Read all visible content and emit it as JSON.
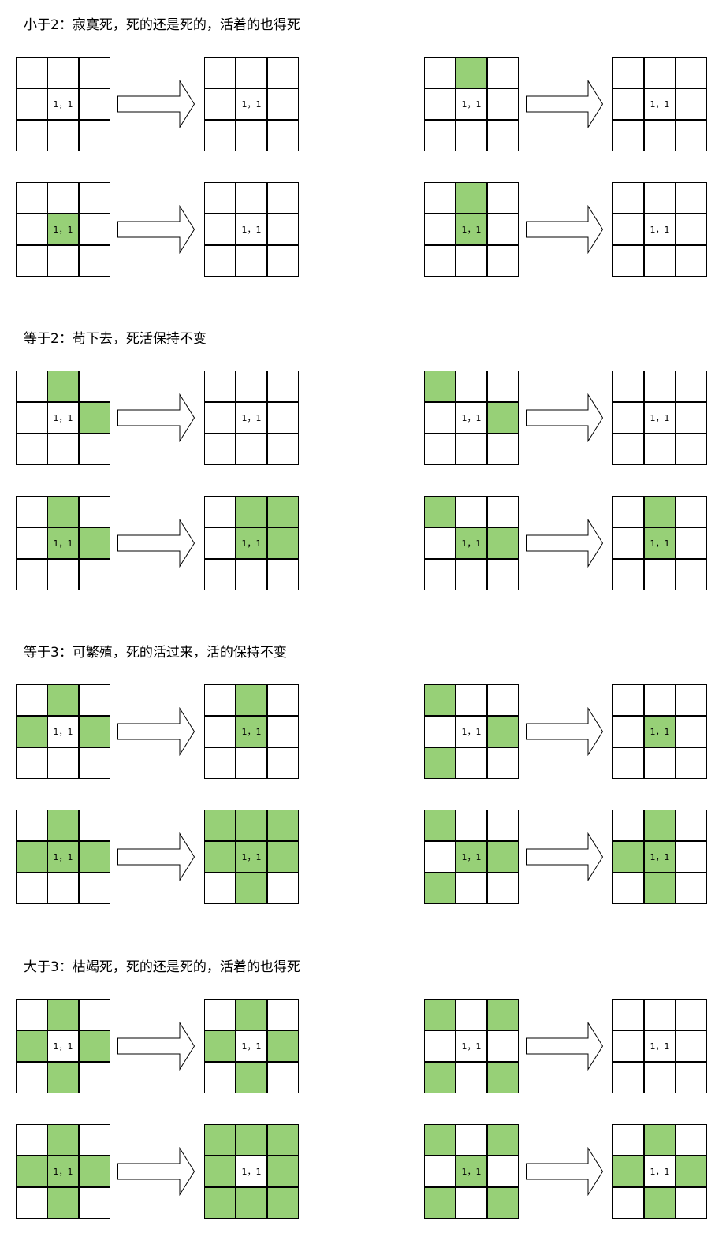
{
  "center_label": "1，1",
  "colors": {
    "alive": "#97d077",
    "dead": "#ffffff",
    "border": "#000000"
  },
  "arrow_icon": "right-arrow-icon",
  "sections": [
    {
      "title": "小于2：寂寞死，死的还是死的，活着的也得死",
      "examples": [
        {
          "before": [
            0,
            0,
            0,
            0,
            0,
            0,
            0,
            0,
            0
          ],
          "after": [
            0,
            0,
            0,
            0,
            0,
            0,
            0,
            0,
            0
          ]
        },
        {
          "before": [
            0,
            1,
            0,
            0,
            0,
            0,
            0,
            0,
            0
          ],
          "after": [
            0,
            0,
            0,
            0,
            0,
            0,
            0,
            0,
            0
          ]
        },
        {
          "before": [
            0,
            0,
            0,
            0,
            1,
            0,
            0,
            0,
            0
          ],
          "after": [
            0,
            0,
            0,
            0,
            0,
            0,
            0,
            0,
            0
          ]
        },
        {
          "before": [
            0,
            1,
            0,
            0,
            1,
            0,
            0,
            0,
            0
          ],
          "after": [
            0,
            0,
            0,
            0,
            0,
            0,
            0,
            0,
            0
          ]
        }
      ]
    },
    {
      "title": "等于2：苟下去，死活保持不变",
      "examples": [
        {
          "before": [
            0,
            1,
            0,
            0,
            0,
            1,
            0,
            0,
            0
          ],
          "after": [
            0,
            0,
            0,
            0,
            0,
            0,
            0,
            0,
            0
          ]
        },
        {
          "before": [
            1,
            0,
            0,
            0,
            0,
            1,
            0,
            0,
            0
          ],
          "after": [
            0,
            0,
            0,
            0,
            0,
            0,
            0,
            0,
            0
          ]
        },
        {
          "before": [
            0,
            1,
            0,
            0,
            1,
            1,
            0,
            0,
            0
          ],
          "after": [
            0,
            1,
            1,
            0,
            1,
            1,
            0,
            0,
            0
          ]
        },
        {
          "before": [
            1,
            0,
            0,
            0,
            1,
            1,
            0,
            0,
            0
          ],
          "after": [
            0,
            1,
            0,
            0,
            1,
            0,
            0,
            0,
            0
          ]
        }
      ]
    },
    {
      "title": "等于3：可繁殖，死的活过来，活的保持不变",
      "examples": [
        {
          "before": [
            0,
            1,
            0,
            1,
            0,
            1,
            0,
            0,
            0
          ],
          "after": [
            0,
            1,
            0,
            0,
            1,
            0,
            0,
            0,
            0
          ]
        },
        {
          "before": [
            1,
            0,
            0,
            0,
            0,
            1,
            1,
            0,
            0
          ],
          "after": [
            0,
            0,
            0,
            0,
            1,
            0,
            0,
            0,
            0
          ]
        },
        {
          "before": [
            0,
            1,
            0,
            1,
            1,
            1,
            0,
            0,
            0
          ],
          "after": [
            1,
            1,
            1,
            1,
            1,
            1,
            0,
            1,
            0
          ]
        },
        {
          "before": [
            1,
            0,
            0,
            0,
            1,
            1,
            1,
            0,
            0
          ],
          "after": [
            0,
            1,
            0,
            1,
            1,
            0,
            0,
            1,
            0
          ]
        }
      ]
    },
    {
      "title": "大于3：枯竭死，死的还是死的，活着的也得死",
      "examples": [
        {
          "before": [
            0,
            1,
            0,
            1,
            0,
            1,
            0,
            1,
            0
          ],
          "after": [
            0,
            1,
            0,
            1,
            0,
            1,
            0,
            1,
            0
          ]
        },
        {
          "before": [
            1,
            0,
            1,
            0,
            0,
            0,
            1,
            0,
            1
          ],
          "after": [
            0,
            0,
            0,
            0,
            0,
            0,
            0,
            0,
            0
          ]
        },
        {
          "before": [
            0,
            1,
            0,
            1,
            1,
            1,
            0,
            1,
            0
          ],
          "after": [
            1,
            1,
            1,
            1,
            0,
            1,
            1,
            1,
            1
          ]
        },
        {
          "before": [
            1,
            0,
            1,
            0,
            1,
            0,
            1,
            0,
            1
          ],
          "after": [
            0,
            1,
            0,
            1,
            0,
            1,
            0,
            1,
            0
          ]
        }
      ]
    }
  ]
}
